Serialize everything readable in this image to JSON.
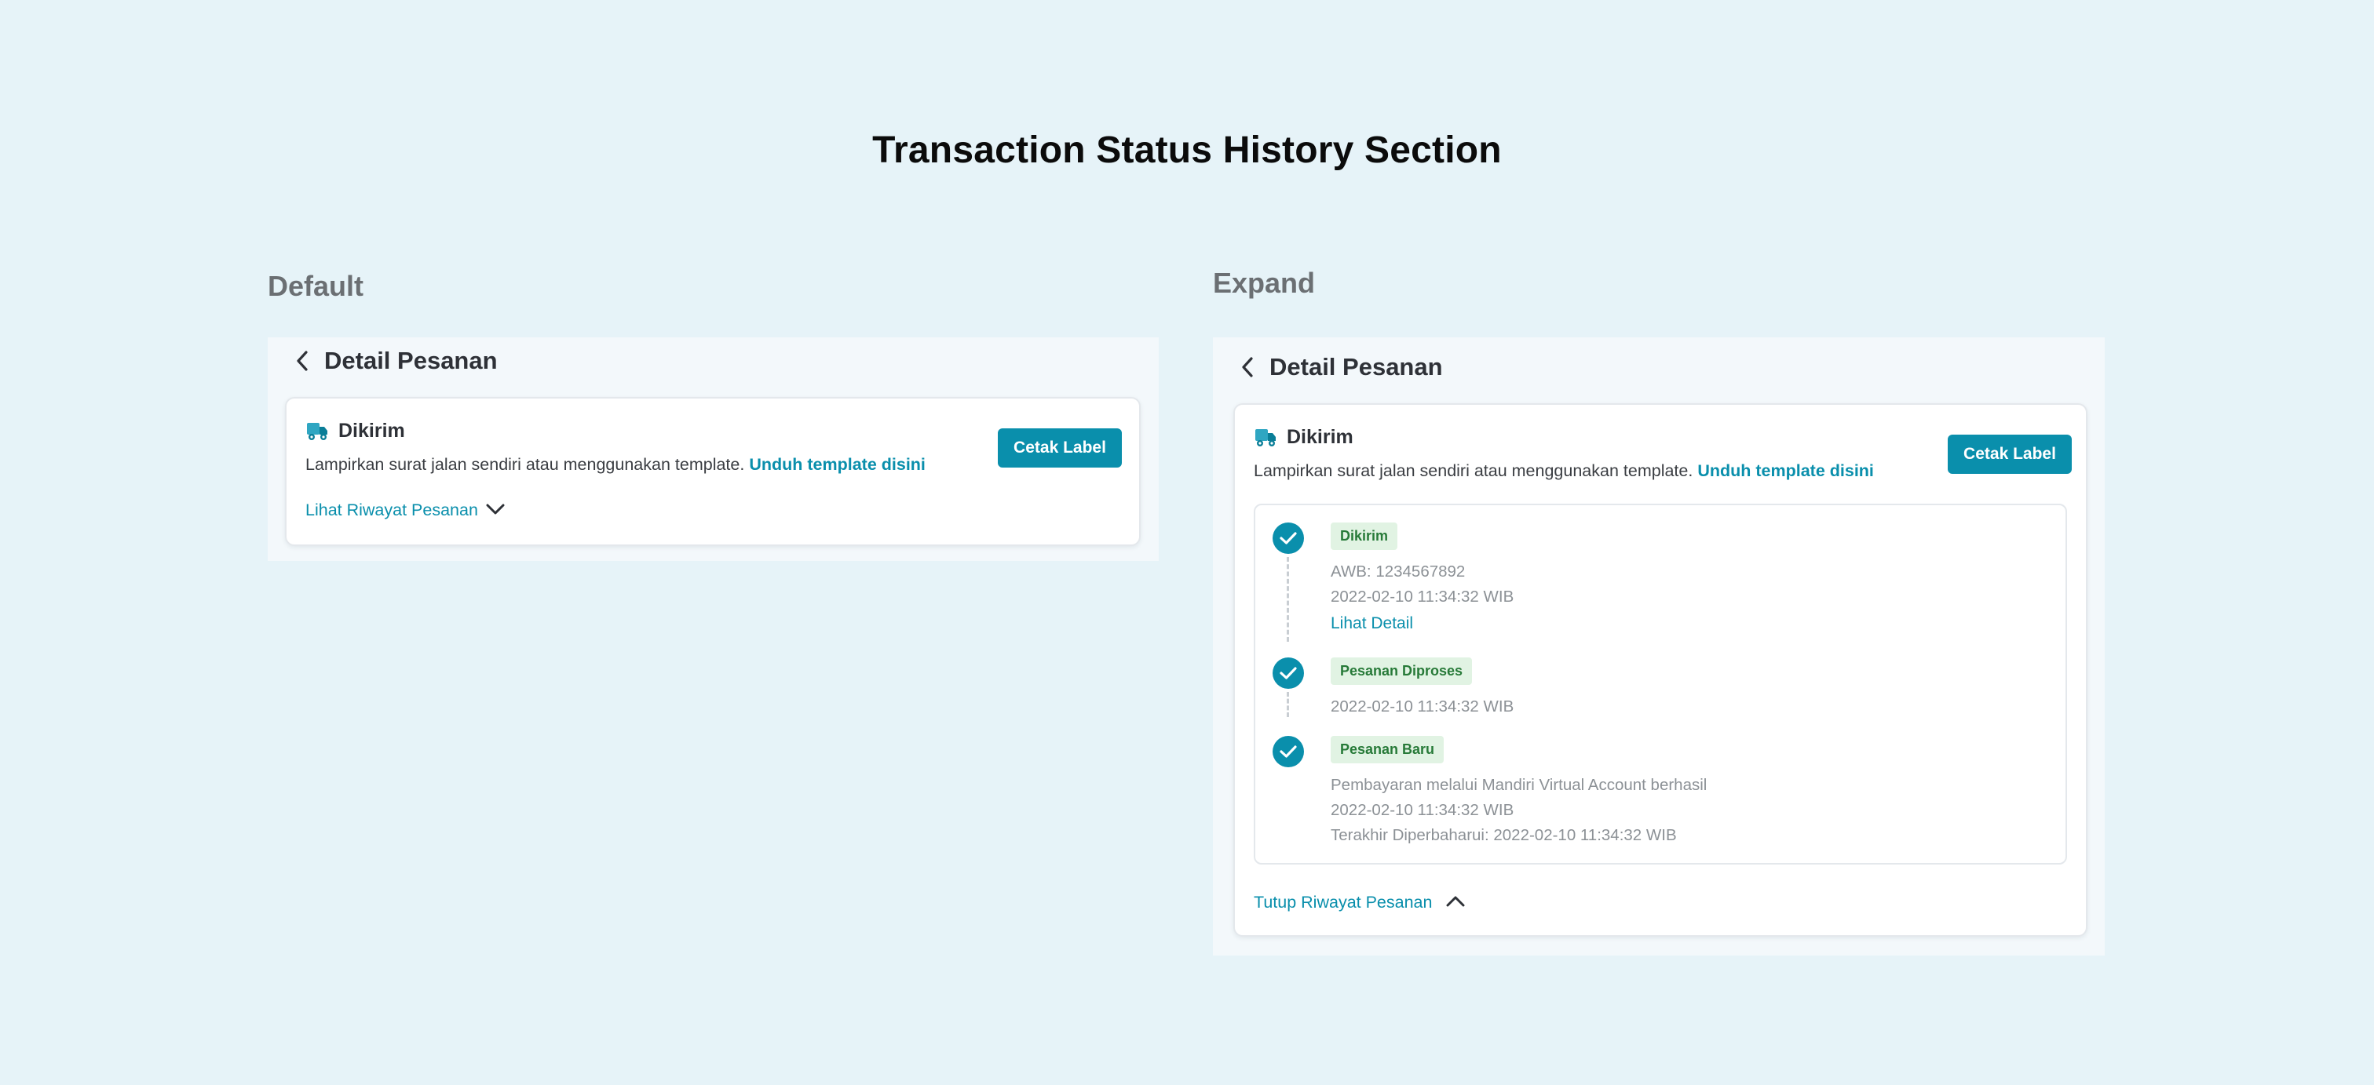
{
  "page_title": "Transaction Status History  Section",
  "labels": {
    "default": "Default",
    "expand": "Expand"
  },
  "header": {
    "title": "Detail Pesanan"
  },
  "status": {
    "name": "Dikirim",
    "description": "Lampirkan surat jalan sendiri atau menggunakan template.",
    "template_link": "Unduh template disini",
    "print_button": "Cetak Label"
  },
  "toggle": {
    "open_label": "Lihat Riwayat Pesanan",
    "close_label": "Tutup Riwayat Pesanan"
  },
  "history": [
    {
      "badge": "Dikirim",
      "awb": "AWB: 1234567892",
      "time": "2022-02-10 11:34:32 WIB",
      "link": "Lihat Detail"
    },
    {
      "badge": "Pesanan Diproses",
      "time": "2022-02-10 11:34:32 WIB"
    },
    {
      "badge": "Pesanan Baru",
      "note": "Pembayaran melalui Mandiri Virtual Account berhasil",
      "time": "2022-02-10 11:34:32 WIB",
      "updated": "Terakhir Diperbaharui: 2022-02-10 11:34:32 WIB"
    }
  ],
  "colors": {
    "accent": "#0A8FAC",
    "badge_bg": "#E1F3E3",
    "badge_text": "#277A38",
    "background": "#E6F3F8"
  }
}
